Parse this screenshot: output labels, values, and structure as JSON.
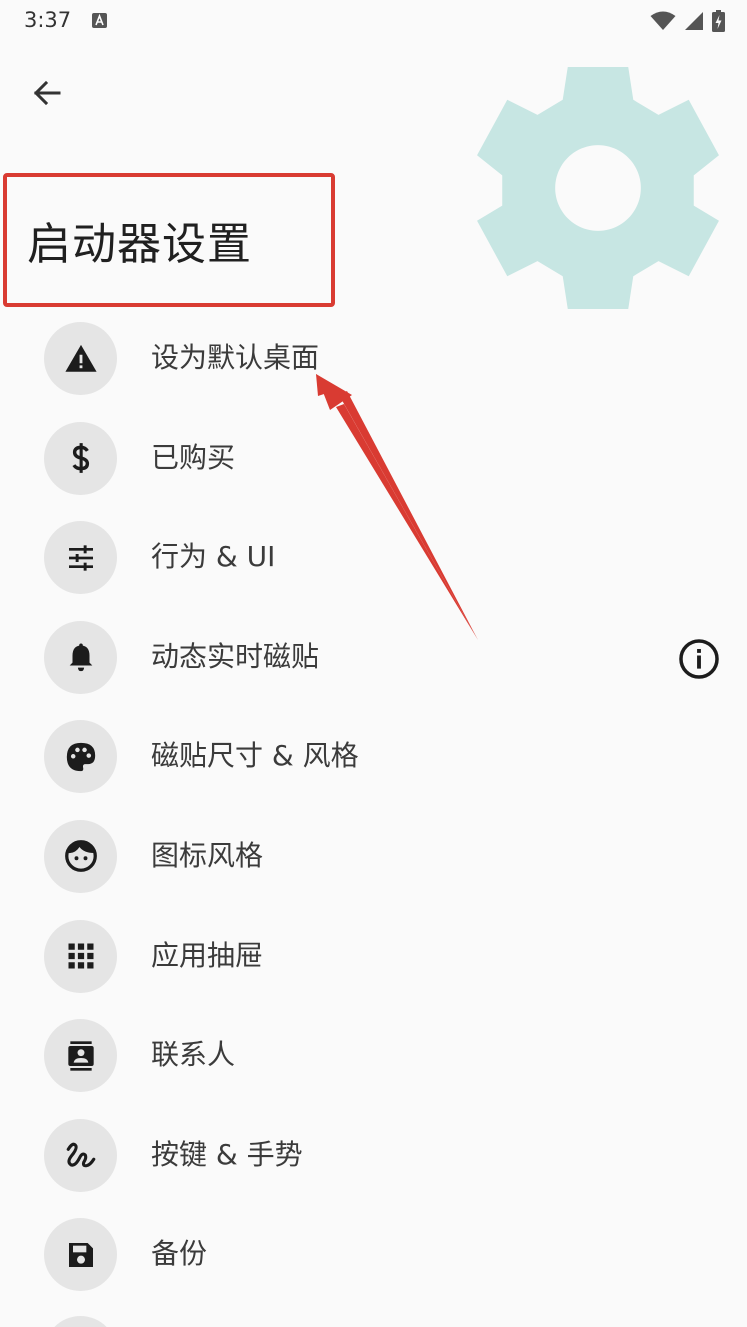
{
  "status_bar": {
    "time": "3:37",
    "notification_icon": "a-icon",
    "wifi_icon": "wifi-icon",
    "signal_icon": "signal-icon",
    "battery_icon": "battery-charging-icon"
  },
  "header": {
    "back_icon": "arrow-back-icon",
    "title": "启动器设置",
    "hero_icon": "gear-icon",
    "hero_color": "#c7e6e3"
  },
  "annotation": {
    "highlight_color": "#d93b32"
  },
  "settings": [
    {
      "label": "设为默认桌面",
      "icon": "warning-icon"
    },
    {
      "label": "已购买",
      "icon": "dollar-icon"
    },
    {
      "label": "行为 & UI",
      "icon": "tune-icon"
    },
    {
      "label": "动态实时磁贴",
      "icon": "bell-icon",
      "trailing_icon": "info-icon"
    },
    {
      "label": "磁贴尺寸 & 风格",
      "icon": "palette-icon"
    },
    {
      "label": "图标风格",
      "icon": "face-icon"
    },
    {
      "label": "应用抽屉",
      "icon": "apps-grid-icon"
    },
    {
      "label": "联系人",
      "icon": "contact-card-icon"
    },
    {
      "label": "按键 & 手势",
      "icon": "gesture-icon"
    },
    {
      "label": "备份",
      "icon": "save-icon"
    }
  ]
}
